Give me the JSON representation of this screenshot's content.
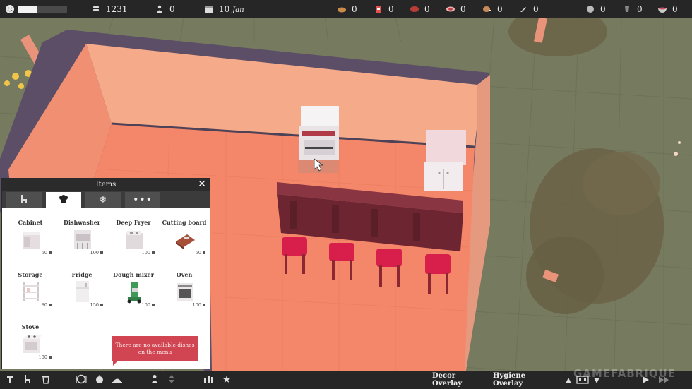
{
  "topbar": {
    "coins": "1231",
    "staff": "0",
    "date_day": "10",
    "date_month": "Jan",
    "happiness_fraction": 0.38,
    "ingredients": [
      {
        "icon": "bread-icon",
        "value": "0"
      },
      {
        "icon": "meat-icon",
        "value": "0"
      },
      {
        "icon": "steak-icon",
        "value": "0"
      },
      {
        "icon": "fish-icon",
        "value": "0"
      },
      {
        "icon": "chicken-icon",
        "value": "0"
      },
      {
        "icon": "knife-icon",
        "value": "0"
      }
    ],
    "resources": [
      {
        "icon": "plate-icon",
        "value": "0"
      },
      {
        "icon": "drink-icon",
        "value": "0"
      },
      {
        "icon": "bowl-icon",
        "value": "0"
      }
    ]
  },
  "panel": {
    "title": "Items",
    "tabs": [
      "chair-icon",
      "chef-hat-icon",
      "snowflake-icon",
      "more-icon"
    ],
    "active_tab": 1,
    "items": [
      {
        "name": "Cabinet",
        "cost": "50"
      },
      {
        "name": "Dishwasher",
        "cost": "100"
      },
      {
        "name": "Deep Fryer",
        "cost": "100"
      },
      {
        "name": "Cutting board",
        "cost": "50"
      },
      {
        "name": "Storage",
        "cost": "80"
      },
      {
        "name": "Fridge",
        "cost": "150"
      },
      {
        "name": "Dough mixer",
        "cost": "100"
      },
      {
        "name": "Oven",
        "cost": "100"
      },
      {
        "name": "Stove",
        "cost": "100"
      }
    ]
  },
  "tooltip": {
    "text": "There are no available dishes on the menu"
  },
  "bottombar": {
    "decor_overlay": "Decor Overlay",
    "hygiene_overlay": "Hygiene Overlay"
  },
  "watermark": "GAMEFABRIQUE",
  "colors": {
    "floor": "#f4876a",
    "wall_outer": "#5b4e66",
    "wall_inner": "#f5aa8a",
    "counter": "#7a2a35",
    "stool_seat": "#d81f4b",
    "grass": "#767a5f",
    "tooltip": "#d04551"
  }
}
